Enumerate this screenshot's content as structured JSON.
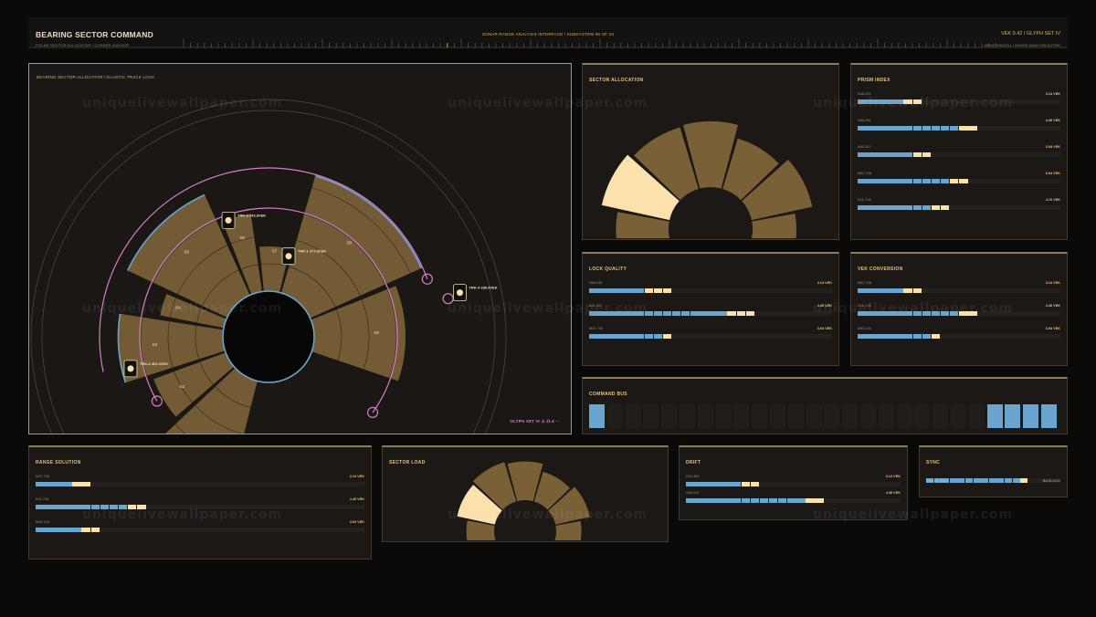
{
  "header": {
    "title": "BEARING SECTOR COMMAND",
    "subtitle": "POLAR SECTOR ALLOCATOR / CORNER ANCHOR",
    "center": "SONAR RANGE ANALYSIS INTERFACE / SUBSYSTEM 08 OF 10",
    "version": "VEK 0.42 / GLYPH SET IV",
    "mode": "MODE RADIOLL / RANGE ANALYSIS ACTIVE"
  },
  "main": {
    "title": "BEARING SECTOR ALLOCATOR / ELASTIC TRACK LOCK",
    "glyph_label": "GLYPH SET IV ⚠ ☊ ⩙ ⋯",
    "sectors": [
      {
        "label": "S1",
        "start": 193,
        "end": 228,
        "outer": 178
      },
      {
        "label": "S2",
        "start": 228,
        "end": 251,
        "outer": 134
      },
      {
        "label": "S3",
        "start": 251,
        "end": 280,
        "outer": 164
      },
      {
        "label": "S4",
        "start": 280,
        "end": 294,
        "outer": 121
      },
      {
        "label": "S5",
        "start": 294,
        "end": 337,
        "outer": 170
      },
      {
        "label": "S6",
        "start": 337,
        "end": 353,
        "outer": 136
      },
      {
        "label": "S7",
        "start": 353,
        "end": 375,
        "outer": 99
      },
      {
        "label": "S8",
        "start": 375,
        "end": 427,
        "outer": 183
      },
      {
        "label": "S9",
        "start": 427,
        "end": 470,
        "outer": 150
      }
    ],
    "tracks": [
      {
        "label": "TRK-2  401.0VEK",
        "angle": 257,
        "radius": 155
      },
      {
        "label": "TRK-3  243.8VEK",
        "angle": 341,
        "radius": 135
      },
      {
        "label": "TRK-1  377.8VEK",
        "angle": 374,
        "radius": 91
      },
      {
        "label": "TRK-4  289.4VEK",
        "angle": 437,
        "radius": 215
      }
    ]
  },
  "sector_allocation": {
    "title": "SECTOR ALLOCATION",
    "slices": [
      {
        "value": 0.72,
        "highlight": false
      },
      {
        "value": 0.95,
        "highlight": true
      },
      {
        "value": 0.88,
        "highlight": false
      },
      {
        "value": 0.9,
        "highlight": false
      },
      {
        "value": 0.72,
        "highlight": false
      },
      {
        "value": 0.85,
        "highlight": false
      },
      {
        "value": 0.6,
        "highlight": false
      }
    ]
  },
  "prism_index": {
    "title": "PRISM INDEX",
    "rows": [
      {
        "label": "K58-225",
        "value": "3.14 VEK",
        "blue": 5,
        "yellow": 2
      },
      {
        "label": "S56-246",
        "value": "4.45 VEK",
        "blue": 11,
        "yellow": 2
      },
      {
        "label": "K60-297",
        "value": "3.94 VEK",
        "blue": 6,
        "yellow": 2
      },
      {
        "label": "M22-728",
        "value": "5.64 VEK",
        "blue": 10,
        "yellow": 2
      },
      {
        "label": "K21-718",
        "value": "4.76 VEK",
        "blue": 8,
        "yellow": 2
      }
    ]
  },
  "lock_quality": {
    "title": "LOCK QUALITY",
    "rows": [
      {
        "label": "S56-246",
        "value": "3.14 VEK",
        "blue": 6,
        "yellow": 3
      },
      {
        "label": "K61-297",
        "value": "4.45 VEK",
        "blue": 15,
        "yellow": 3
      },
      {
        "label": "M22-728",
        "value": "3.94 VEK",
        "blue": 8,
        "yellow": 1
      }
    ]
  },
  "vek_conversion": {
    "title": "VEK CONVERSION",
    "rows": [
      {
        "label": "M22-728",
        "value": "3.14 VEK",
        "blue": 5,
        "yellow": 2
      },
      {
        "label": "K21-718",
        "value": "4.45 VEK",
        "blue": 11,
        "yellow": 2
      },
      {
        "label": "M43-144",
        "value": "3.94 VEK",
        "blue": 8,
        "yellow": 1
      }
    ]
  },
  "command_bus": {
    "title": "COMMAND BUS",
    "cells": [
      1,
      0,
      0,
      0,
      0,
      0,
      0,
      0,
      0,
      0,
      0,
      0,
      0,
      0,
      0,
      0,
      0,
      0,
      0,
      0,
      0,
      0,
      1,
      1,
      1,
      1
    ]
  },
  "range_solution": {
    "title": "RANGE SOLUTION",
    "rows": [
      {
        "label": "M22-728",
        "value": "3.14 VEK",
        "blue": 4,
        "yellow": 2
      },
      {
        "label": "K21-718",
        "value": "4.45 VEK",
        "blue": 10,
        "yellow": 2
      },
      {
        "label": "M43-144",
        "value": "3.94 VEK",
        "blue": 5,
        "yellow": 2
      }
    ]
  },
  "sector_load": {
    "title": "SECTOR LOAD",
    "slices": [
      {
        "value": 0.66,
        "highlight": false
      },
      {
        "value": 0.92,
        "highlight": true
      },
      {
        "value": 0.98,
        "highlight": false
      },
      {
        "value": 0.92,
        "highlight": false
      },
      {
        "value": 0.74,
        "highlight": false
      },
      {
        "value": 0.84,
        "highlight": false
      },
      {
        "value": 0.6,
        "highlight": false
      }
    ]
  },
  "drift": {
    "title": "DRIFT",
    "rows": [
      {
        "label": "K18-364",
        "value": "3.14 VEK",
        "blue": 6,
        "yellow": 2
      },
      {
        "label": "S28-412",
        "value": "4.45 VEK",
        "blue": 13,
        "yellow": 2
      }
    ]
  },
  "sync": {
    "title": "SYNC",
    "blue": 12,
    "yellow": 1,
    "left_label": "PHASE 0652",
    "right_label": "BUSLOCK"
  },
  "watermark": "uniquelivewallpaper.com",
  "colors": {
    "blue": "#6aa5cf",
    "cream": "#fbe2ac",
    "sector_fill": "#84683b",
    "pink": "#d580c8",
    "gold_text": "#e3c47e"
  }
}
